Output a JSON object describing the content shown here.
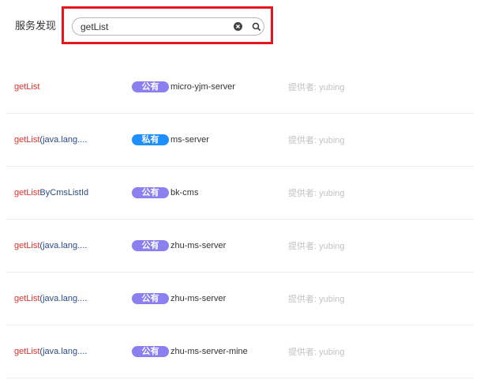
{
  "page": {
    "title": "服务发现"
  },
  "search": {
    "value": "getList"
  },
  "accent": {
    "highlight_border": "#e8141b",
    "match_text": "#e5312f",
    "public_badge": "#8c7ff0",
    "private_badge": "#1e8fff"
  },
  "services": [
    {
      "method_match": "getList",
      "method_rest": "",
      "visibility": "公有",
      "server": "micro-yjm-server",
      "provider": "提供者: yubing"
    },
    {
      "method_match": "getList",
      "method_rest": "(java.lang....",
      "visibility": "私有",
      "server": "ms-server",
      "provider": "提供者: yubing"
    },
    {
      "method_match": "getList",
      "method_rest": "ByCmsListId",
      "visibility": "公有",
      "server": "bk-cms",
      "provider": "提供者: yubing"
    },
    {
      "method_match": "getList",
      "method_rest": "(java.lang....",
      "visibility": "公有",
      "server": "zhu-ms-server",
      "provider": "提供者: yubing"
    },
    {
      "method_match": "getList",
      "method_rest": "(java.lang....",
      "visibility": "公有",
      "server": "zhu-ms-server",
      "provider": "提供者: yubing"
    },
    {
      "method_match": "getList",
      "method_rest": "(java.lang....",
      "visibility": "公有",
      "server": "zhu-ms-server-mine",
      "provider": "提供者: yubing"
    }
  ]
}
